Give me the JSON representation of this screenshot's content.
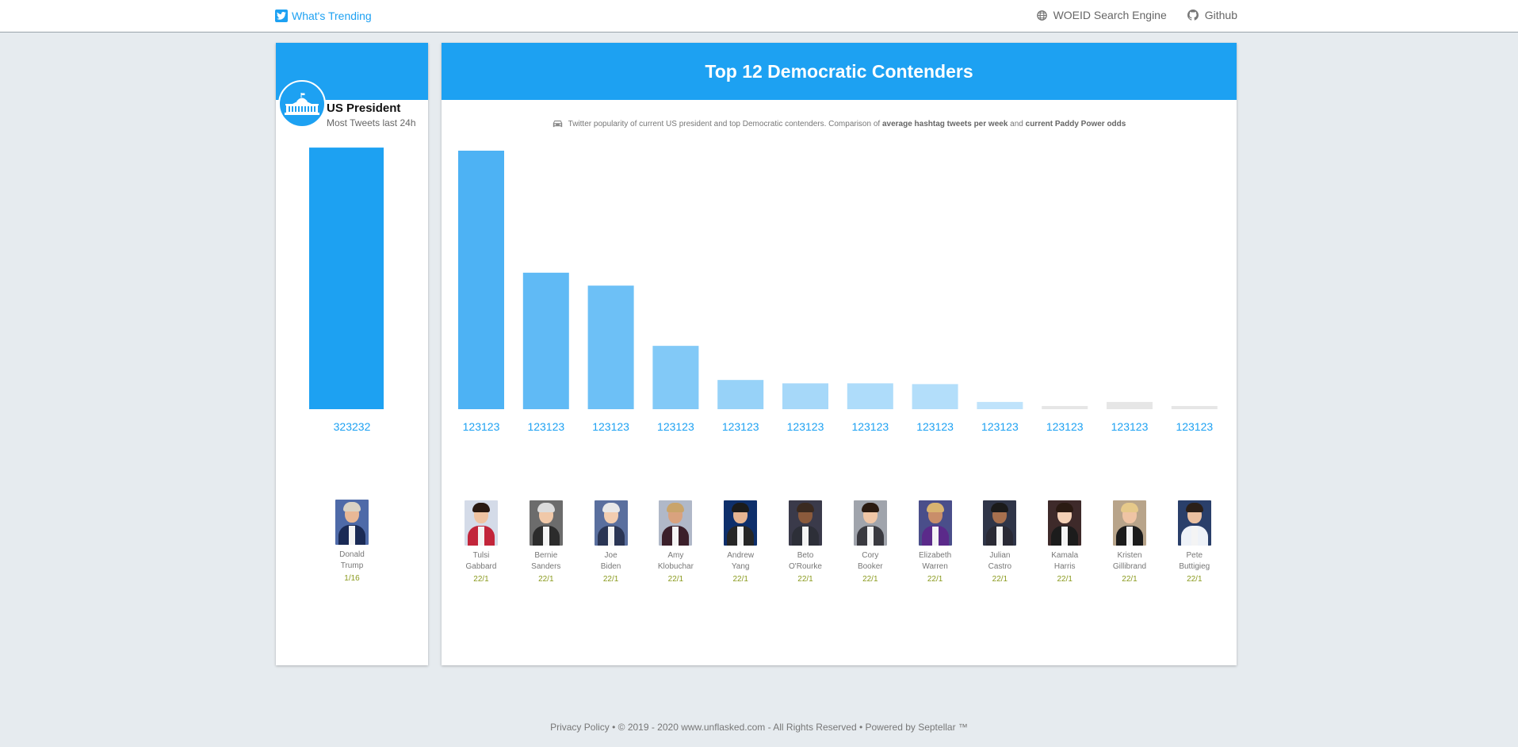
{
  "nav": {
    "brand": "What's Trending",
    "links": [
      {
        "label": "WOEID Search Engine",
        "icon": "globe-icon"
      },
      {
        "label": "Github",
        "icon": "github-icon"
      }
    ]
  },
  "president_panel": {
    "title": "US President",
    "subtitle": "Most Tweets last 24h",
    "icon": "white-house-icon"
  },
  "main_panel": {
    "title": "Top 12 Democratic Contenders",
    "subtitle_parts": [
      "Twitter popularity of current US president and top Democratic contenders. Comparison of ",
      "average hashtag tweets per week",
      " and ",
      "current Paddy Power odds"
    ],
    "subtitle_icon": "car-icon"
  },
  "colors": {
    "accent": "#1da1f2",
    "odds": "#8a9a1e",
    "muted_bar": "#e6e6e6"
  },
  "chart_data": [
    {
      "type": "bar",
      "categories": [
        "Donald Trump"
      ],
      "values": [
        323232
      ],
      "value_labels": [
        "323232"
      ],
      "odds": [
        "1/16"
      ],
      "ylim": [
        0,
        340000
      ]
    },
    {
      "type": "bar",
      "categories": [
        "Tulsi Gabbard",
        "Bernie Sanders",
        "Joe Biden",
        "Amy Klobuchar",
        "Andrew Yang",
        "Beto O'Rourke",
        "Cory Booker",
        "Elizabeth Warren",
        "Julian Castro",
        "Kamala Harris",
        "Kristen Gillibrand",
        "Pete Buttigieg"
      ],
      "values": [
        1000,
        528,
        478,
        245,
        113,
        100,
        100,
        97,
        28,
        12,
        28,
        12
      ],
      "value_labels": [
        "123123",
        "123123",
        "123123",
        "123123",
        "123123",
        "123123",
        "123123",
        "123123",
        "123123",
        "123123",
        "123123",
        "123123"
      ],
      "odds": [
        "22/1",
        "22/1",
        "22/1",
        "22/1",
        "22/1",
        "22/1",
        "22/1",
        "22/1",
        "22/1",
        "22/1",
        "22/1",
        "22/1"
      ],
      "bar_colors": [
        "#4db2f4",
        "#60baf5",
        "#6dc0f6",
        "#82c9f7",
        "#97d2f8",
        "#a6d8f9",
        "#aedcfa",
        "#b3defa",
        "#bfe3fb",
        "#e6e6e6",
        "#e6e6e6",
        "#e6e6e6"
      ],
      "ylim": [
        0,
        1000
      ]
    }
  ],
  "candidates": [
    {
      "first": "Donald",
      "last": "Trump",
      "odds": "1/16"
    },
    {
      "first": "Tulsi",
      "last": "Gabbard",
      "odds": "22/1"
    },
    {
      "first": "Bernie",
      "last": "Sanders",
      "odds": "22/1"
    },
    {
      "first": "Joe",
      "last": "Biden",
      "odds": "22/1"
    },
    {
      "first": "Amy",
      "last": "Klobuchar",
      "odds": "22/1"
    },
    {
      "first": "Andrew",
      "last": "Yang",
      "odds": "22/1"
    },
    {
      "first": "Beto",
      "last": "O'Rourke",
      "odds": "22/1"
    },
    {
      "first": "Cory",
      "last": "Booker",
      "odds": "22/1"
    },
    {
      "first": "Elizabeth",
      "last": "Warren",
      "odds": "22/1"
    },
    {
      "first": "Julian",
      "last": "Castro",
      "odds": "22/1"
    },
    {
      "first": "Kamala",
      "last": "Harris",
      "odds": "22/1"
    },
    {
      "first": "Kristen",
      "last": "Gillibrand",
      "odds": "22/1"
    },
    {
      "first": "Pete",
      "last": "Buttigieg",
      "odds": "22/1"
    }
  ],
  "footer": {
    "text": "Privacy Policy • © 2019 - 2020 www.unflasked.com - All Rights Reserved • Powered by Septellar ™"
  }
}
